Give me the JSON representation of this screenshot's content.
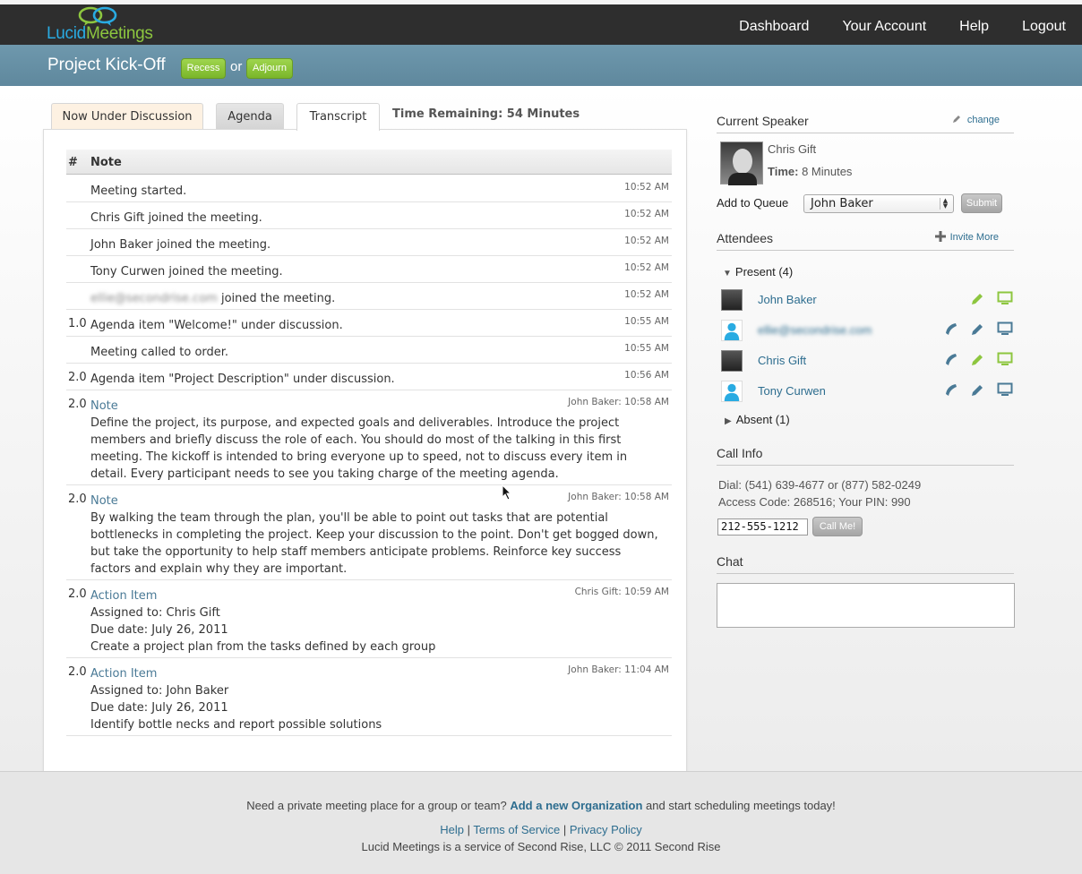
{
  "app": {
    "logo_part1": "Lucid",
    "logo_part2": "Meetings"
  },
  "nav": [
    "Dashboard",
    "Your Account",
    "Help",
    "Logout"
  ],
  "meeting": {
    "title": "Project Kick-Off",
    "recess": "Recess",
    "or": "or",
    "adjourn": "Adjourn"
  },
  "tabs": [
    "Now Under Discussion",
    "Agenda",
    "Transcript"
  ],
  "time_remaining": "Time Remaining: 54 Minutes",
  "transcript": {
    "col_num": "#",
    "col_note": "Note",
    "rows": [
      {
        "num": "",
        "text": "Meeting started.",
        "time": "10:52 AM"
      },
      {
        "num": "",
        "text": "Chris Gift joined the meeting.",
        "time": "10:52 AM"
      },
      {
        "num": "",
        "text": "John Baker joined the meeting.",
        "time": "10:52 AM"
      },
      {
        "num": "",
        "text": "Tony Curwen joined the meeting.",
        "time": "10:52 AM"
      },
      {
        "num": "",
        "email": "ellie@secondrise.com",
        "text": "joined the meeting.",
        "time": "10:52 AM"
      },
      {
        "num": "1.0",
        "text": "Agenda item \"Welcome!\" under discussion.",
        "time": "10:55 AM"
      },
      {
        "num": "",
        "text": "Meeting called to order.",
        "time": "10:55 AM"
      },
      {
        "num": "2.0",
        "text": "Agenda item \"Project Description\" under discussion.",
        "time": "10:56 AM"
      },
      {
        "num": "2.0",
        "type": "Note",
        "text": "Define the project, its purpose, and expected goals and deliverables. Introduce the project members and briefly discuss the role of each. You should do most of the talking in this first meeting. The kickoff is intended to bring everyone up to speed, not to discuss every item in detail. Every participant needs to see you taking charge of the meeting agenda.",
        "time": "John Baker: 10:58 AM"
      },
      {
        "num": "2.0",
        "type": "Note",
        "text": "By walking the team through the plan, you'll be able to point out tasks that are potential bottlenecks in completing the project. Keep your discussion to the point. Don't get bogged down, but take the opportunity to help staff members anticipate problems. Reinforce key success factors and explain why they are important.",
        "time": "John Baker: 10:58 AM"
      },
      {
        "num": "2.0",
        "type": "Action Item",
        "assigned": "Assigned to: Chris Gift",
        "due": "Due date: July 26, 2011",
        "text": "Create a project plan from the tasks defined by each group",
        "time": "Chris Gift: 10:59 AM"
      },
      {
        "num": "2.0",
        "type": "Action Item",
        "assigned": "Assigned to: John Baker",
        "due": "Due date: July 26, 2011",
        "text": "Identify bottle necks and report possible solutions",
        "time": "John Baker: 11:04 AM"
      }
    ]
  },
  "sidebar": {
    "current_speaker": {
      "heading": "Current Speaker",
      "change": "change",
      "name": "Chris Gift",
      "time_label": "Time:",
      "time_value": "8 Minutes"
    },
    "queue": {
      "label": "Add to Queue",
      "selected": "John Baker",
      "submit": "Submit"
    },
    "attendees": {
      "heading": "Attendees",
      "invite": "Invite More",
      "present_label": "Present (4)",
      "absent_label": "Absent (1)",
      "list": [
        {
          "name": "John Baker"
        },
        {
          "name": "ellie@secondrise.com"
        },
        {
          "name": "Chris Gift"
        },
        {
          "name": "Tony Curwen"
        }
      ]
    },
    "call_info": {
      "heading": "Call Info",
      "dial": "Dial: (541) 639-4677 or (877) 582-0249",
      "access": "Access Code: 268516; Your PIN: 990",
      "phone": "212-555-1212",
      "call_button": "Call Me!"
    },
    "chat": {
      "heading": "Chat"
    }
  },
  "footer": {
    "line1_pre": "Need a private meeting place for a group or team?",
    "line1_link": "Add a new Organization",
    "line1_post": "and start scheduling meetings today!",
    "links": [
      "Help",
      "Terms of Service",
      "Privacy Policy"
    ],
    "sep": "|",
    "copyright": "Lucid Meetings is a service of Second Rise, LLC © 2011 Second Rise"
  },
  "colors": {
    "header": "#2e2e2e",
    "titlebar": "#6391a6",
    "green": "#8dc63f",
    "link": "#2d6d8f"
  }
}
